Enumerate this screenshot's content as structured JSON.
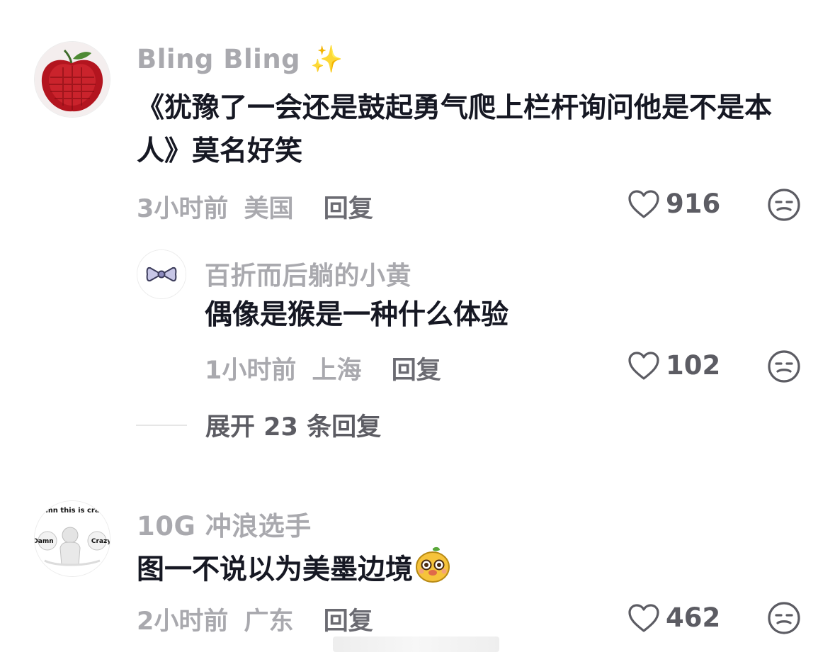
{
  "comments": [
    {
      "username": "Bling Bling",
      "username_emoji": "✨",
      "text": "《犹豫了一会还是鼓起勇气爬上栏杆询问他是不是本人》莫名好笑",
      "time": "3小时前",
      "location": "美国",
      "reply_label": "回复",
      "likes": "916",
      "replies": [
        {
          "username": "百折而后躺的小黄",
          "text": "偶像是猴是一种什么体验",
          "time": "1小时前",
          "location": "上海",
          "reply_label": "回复",
          "likes": "102"
        }
      ],
      "expand_label": "展开 23 条回复"
    },
    {
      "username": "10G 冲浪选手",
      "text": "图一不说以为美墨边境",
      "avatar_text": {
        "top": "amn this is craz",
        "left": "Damn",
        "right": "Crazy"
      },
      "time": "2小时前",
      "location": "广东",
      "reply_label": "回复",
      "likes": "462"
    }
  ],
  "colors": {
    "text": "#161823",
    "secondary": "#a9a9ae",
    "reply": "#6b6b72",
    "icon": "#5c5c63"
  }
}
